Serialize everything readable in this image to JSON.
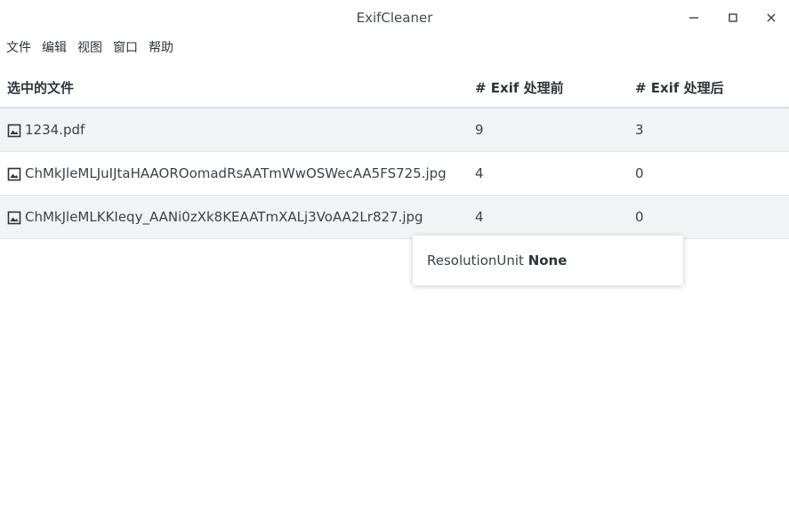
{
  "window": {
    "title": "ExifCleaner"
  },
  "menu": [
    "文件",
    "编辑",
    "视图",
    "窗口",
    "帮助"
  ],
  "table": {
    "headers": {
      "file": "选中的文件",
      "before": "# Exif 处理前",
      "after": "# Exif 处理后"
    },
    "rows": [
      {
        "file": "1234.pdf",
        "before": "9",
        "after": "3"
      },
      {
        "file": "ChMkJleMLJuIJtaHAAOROomadRsAATmWwOSWecAA5FS725.jpg",
        "before": "4",
        "after": "0"
      },
      {
        "file": "ChMkJleMLKKIeqy_AANi0zXk8KEAATmXALj3VoAA2Lr827.jpg",
        "before": "4",
        "after": "0"
      }
    ]
  },
  "tooltip": {
    "key": "ResolutionUnit",
    "value": "None"
  },
  "icons": {
    "minimize": "minimize-icon",
    "maximize": "maximize-icon",
    "close": "close-icon",
    "file": "image-file-icon"
  },
  "colors": {
    "header_border": "#dcdfe3",
    "row_shade": "#f2f3f5",
    "text": "#3c424a"
  }
}
